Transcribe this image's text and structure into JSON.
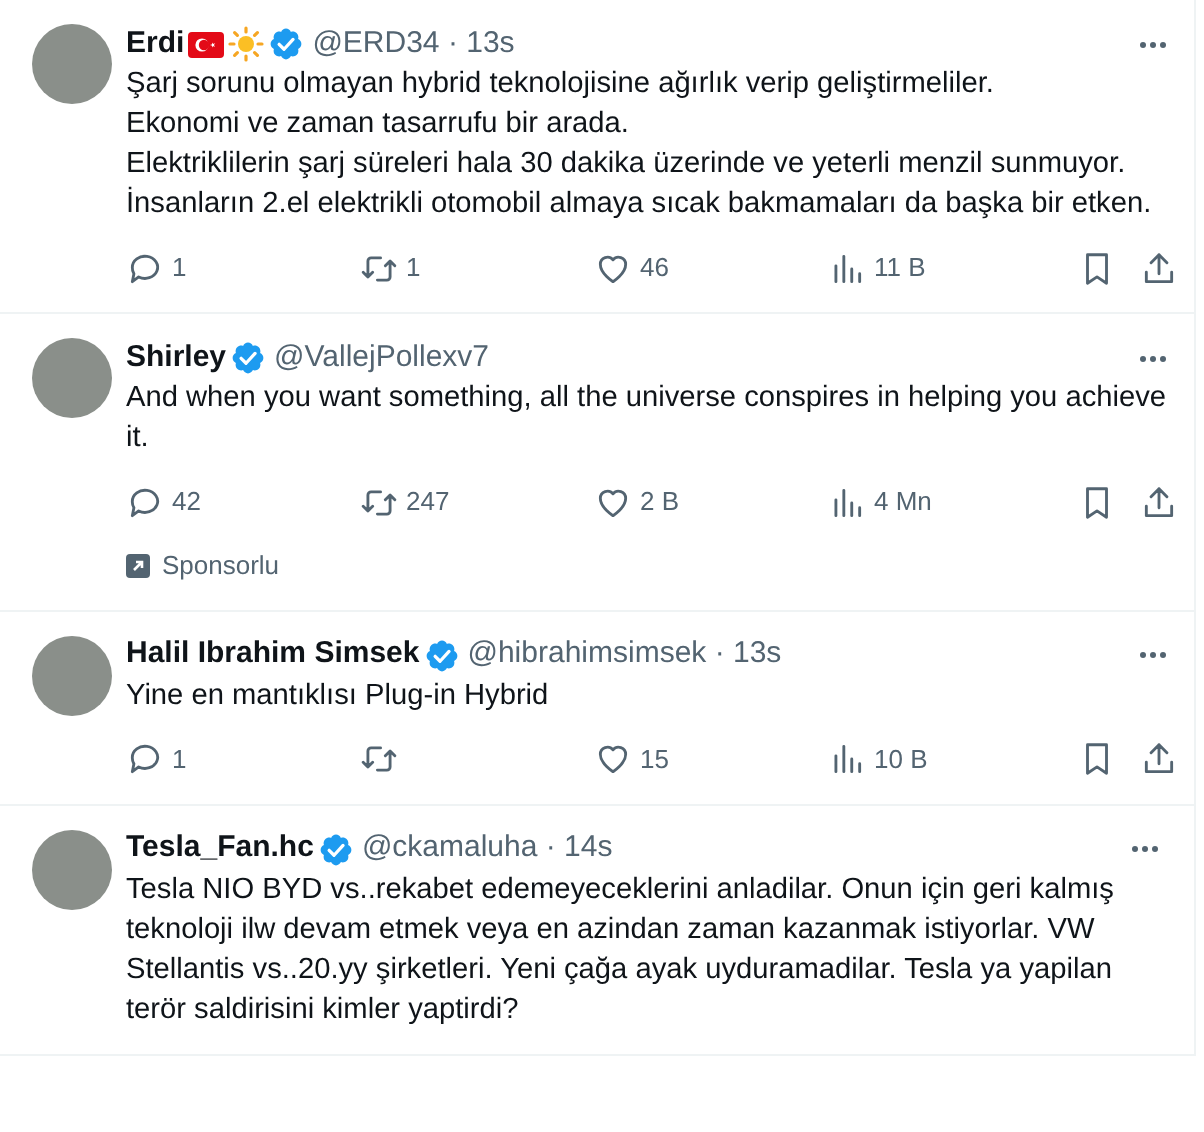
{
  "tweets": [
    {
      "name": "Erdi",
      "flair": true,
      "verified": true,
      "handle": "@ERD34",
      "time": "· 13s",
      "paragraphs": [
        "Şarj sorunu olmayan hybrid teknolojisine ağırlık verip geliştirmeliler.",
        "Ekonomi ve zaman tasarrufu bir arada.",
        "Elektriklilerin şarj süreleri hala 30 dakika üzerinde ve yeterli menzil sunmuyor.",
        "İnsanların 2.el elektrikli otomobil almaya sıcak bakmamaları da başka bir etken."
      ],
      "replies": "1",
      "reposts": "1",
      "likes": "46",
      "views": "11 B"
    },
    {
      "name": "Shirley",
      "verified": true,
      "handle": "@VallejPollexv7",
      "paragraphs": [
        "And when you want something, all the universe conspires in helping you achieve it."
      ],
      "replies": "42",
      "reposts": "247",
      "likes": "2 B",
      "views": "4 Mn",
      "sponsored": "Sponsorlu"
    },
    {
      "name": "Halil Ibrahim Simsek",
      "verified": true,
      "handle": "@hibrahimsimsek",
      "time": "· 13s",
      "paragraphs": [
        "Yine en mantıklısı Plug-in Hybrid"
      ],
      "replies": "1",
      "likes": "15",
      "views": "10 B"
    },
    {
      "name": "Tesla_Fan.hc",
      "verified": true,
      "handle": "@ckamaluha",
      "time": "· 14s",
      "paragraphs": [
        "Tesla NIO BYD vs..rekabet edemeyeceklerini anladilar. Onun için geri kalmış teknoloji ilw devam etmek veya en azindan zaman kazanmak istiyorlar. VW Stellantis vs..20.yy şirketleri. Yeni çağa ayak uyduramadilar. Tesla ya yapilan terör saldirisini kimler yaptirdi?"
      ]
    }
  ]
}
